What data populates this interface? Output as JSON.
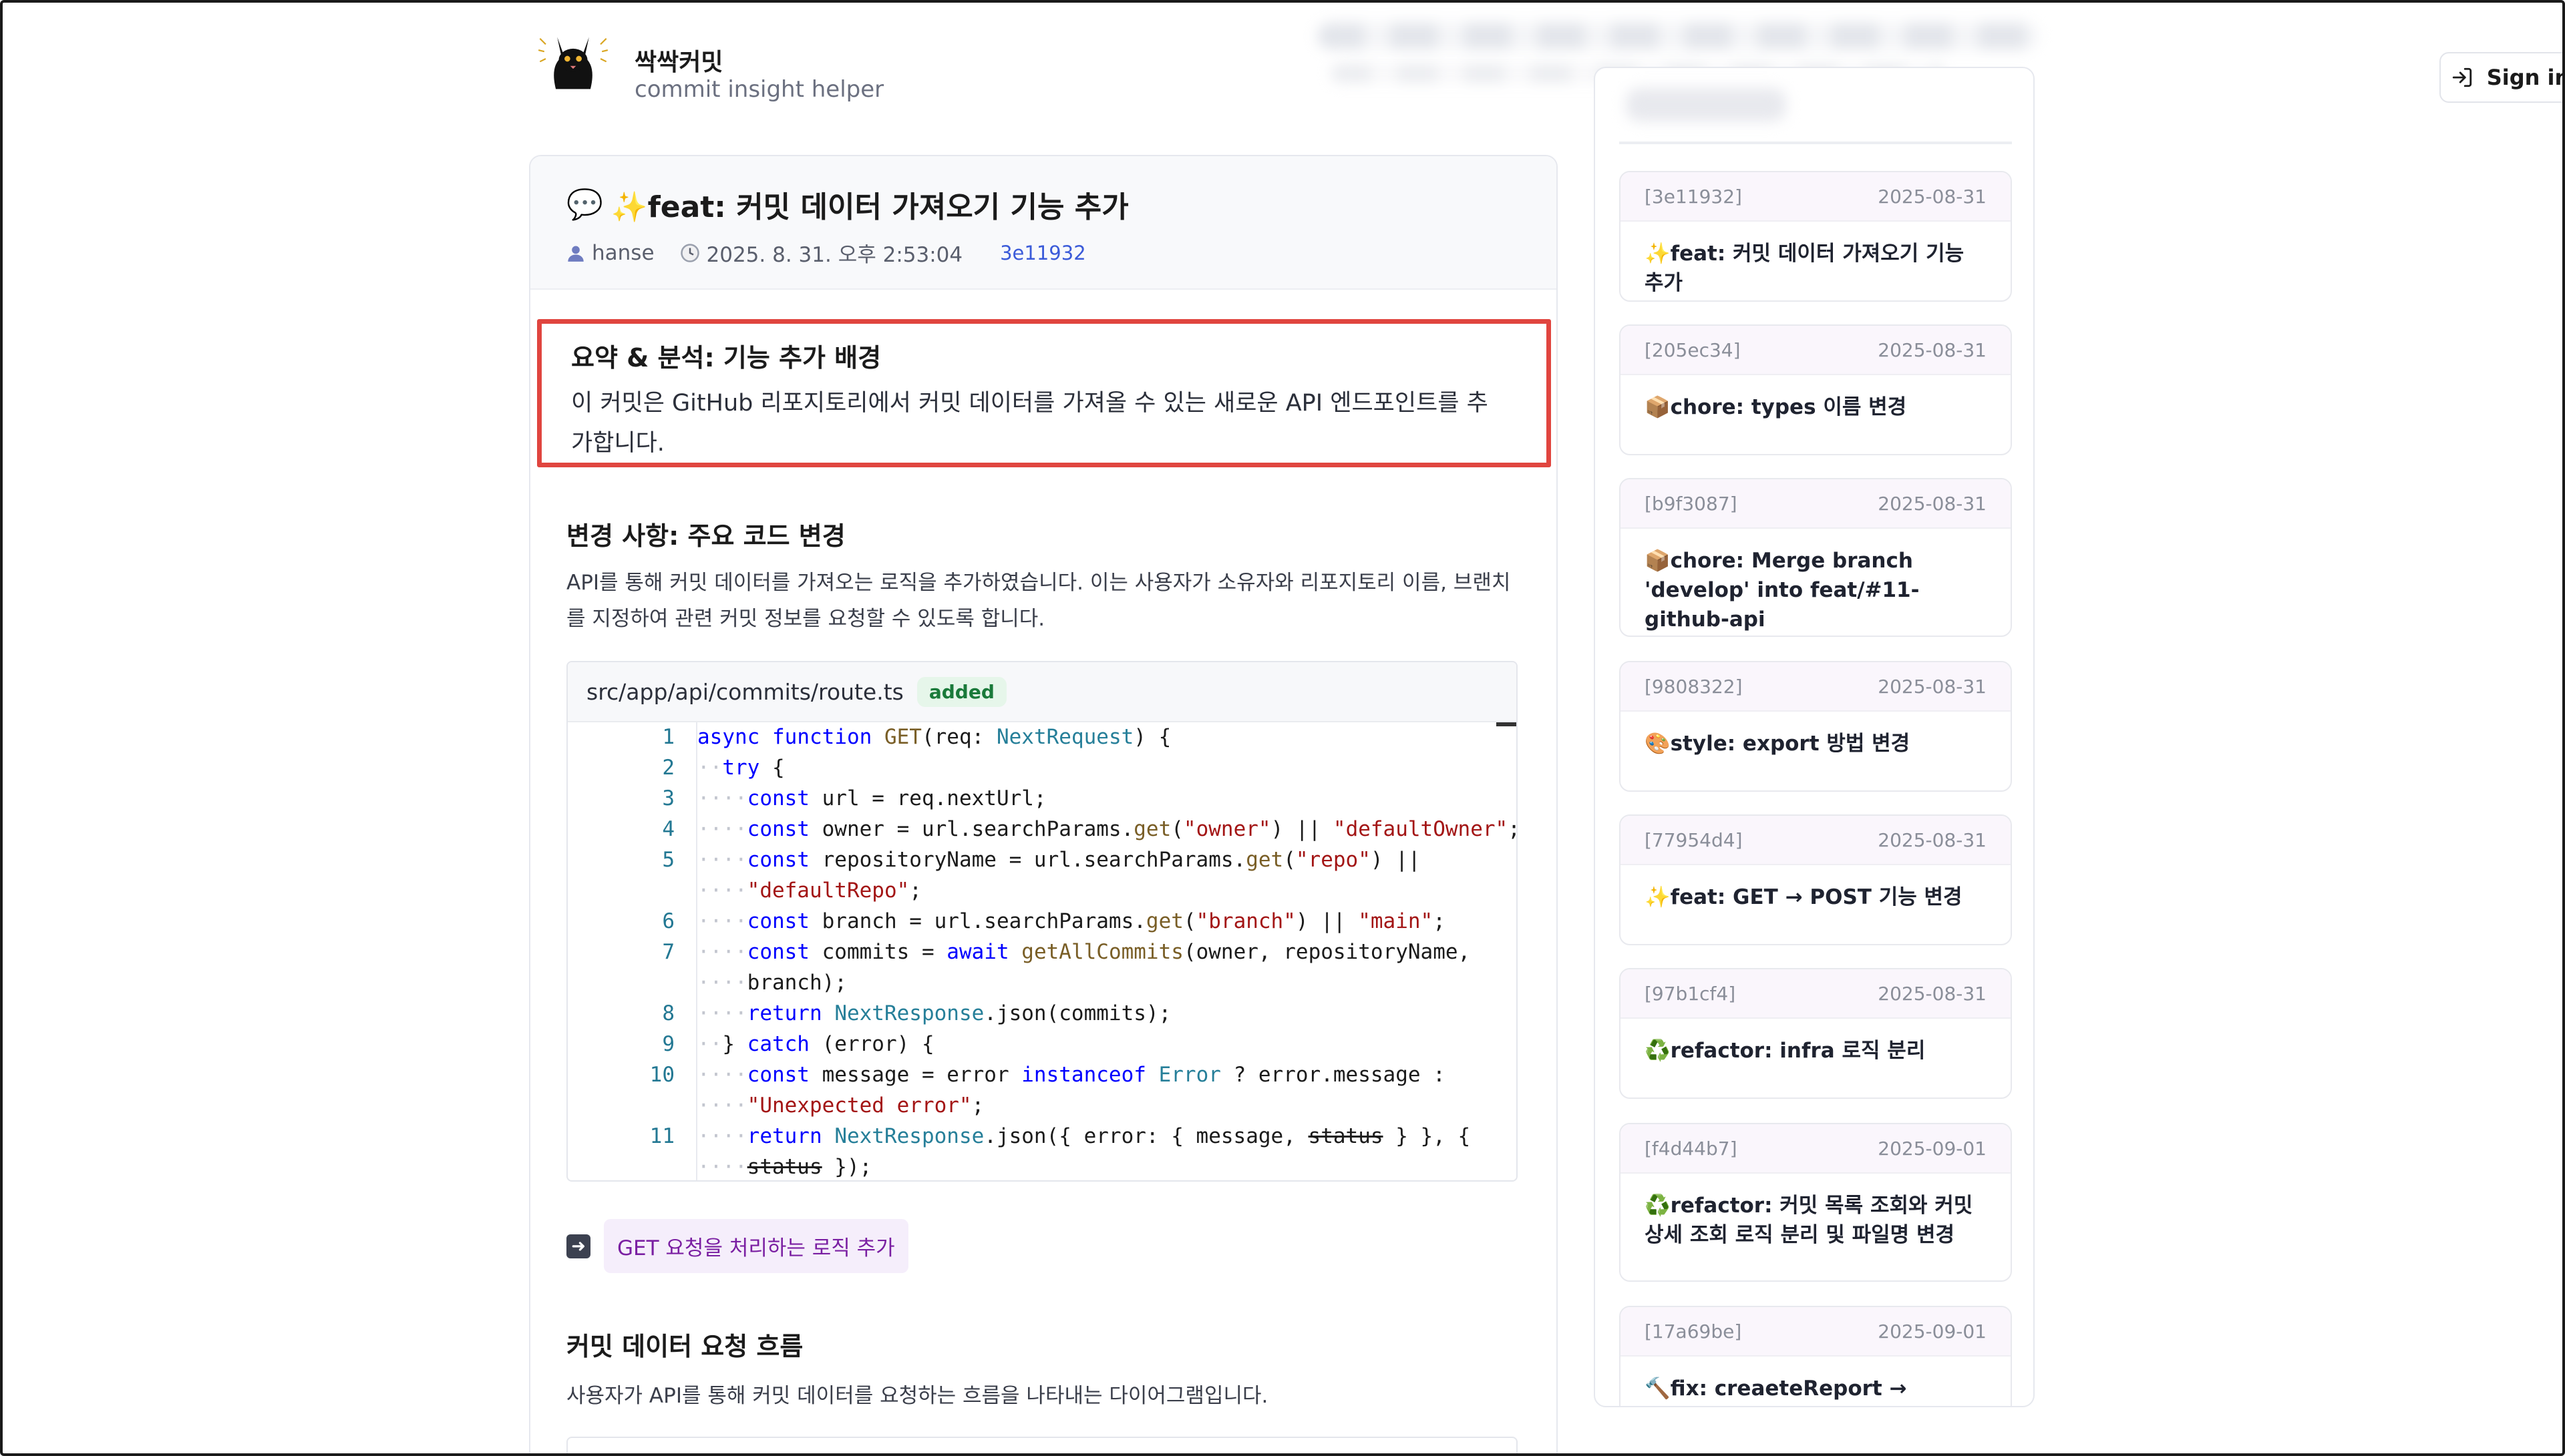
{
  "header": {
    "brand_name": "싹싹커밋",
    "brand_sub": "commit insight helper",
    "signin_label": "Sign in"
  },
  "commit": {
    "title_emoji": "💬",
    "title": "✨feat: 커밋 데이터 가져오기 기능 추가",
    "author": "hanse",
    "date": "2025. 8. 31. 오후 2:53:04",
    "hash": "3e11932"
  },
  "summary": {
    "title": "요약 & 분석: 기능 추가 배경",
    "text": "이 커밋은 GitHub 리포지토리에서 커밋 데이터를 가져올 수 있는 새로운 API 엔드포인트를 추가합니다."
  },
  "changes": {
    "title": "변경 사항: 주요 코드 변경",
    "desc": "API를 통해 커밋 데이터를 가져오는 로직을 추가하였습니다. 이는 사용자가 소유자와 리포지토리 이름, 브랜치를 지정하여 관련 커밋 정보를 요청할 수 있도록 합니다.",
    "file": "src/app/api/commits/route.ts",
    "file_status": "added",
    "note_label": "GET 요청을 처리하는 로직 추가"
  },
  "code_lines": [
    {
      "n": "1",
      "text": "async function GET(req: NextRequest) {"
    },
    {
      "n": "2",
      "text": "try {"
    },
    {
      "n": "3",
      "text": "const url = req.nextUrl;"
    },
    {
      "n": "4",
      "text": "const owner = url.searchParams.get(\"owner\") || \"defaultOwner\";"
    },
    {
      "n": "5",
      "text": "const repositoryName = url.searchParams.get(\"repo\") || \"defaultRepo\";"
    },
    {
      "n": "6",
      "text": "const branch = url.searchParams.get(\"branch\") || \"main\";"
    },
    {
      "n": "7",
      "text": "const commits = await getAllCommits(owner, repositoryName, branch);"
    },
    {
      "n": "8",
      "text": "return NextResponse.json(commits);"
    },
    {
      "n": "9",
      "text": "} catch (error) {"
    },
    {
      "n": "10",
      "text": "const message = error instanceof Error ? error.message : \"Unexpected error\";"
    },
    {
      "n": "11",
      "text": "return NextResponse.json({ error: { message, status } }, { status });"
    }
  ],
  "flow": {
    "title": "커밋 데이터 요청 흐름",
    "desc": "사용자가 API를 통해 커밋 데이터를 요청하는 흐름을 나타내는 다이어그램입니다."
  },
  "commits_list": [
    {
      "hash": "[3e11932]",
      "date": "2025-08-31",
      "msg": "✨feat: 커밋 데이터 가져오기 기능 추가"
    },
    {
      "hash": "[205ec34]",
      "date": "2025-08-31",
      "msg": "📦chore: types 이름 변경"
    },
    {
      "hash": "[b9f3087]",
      "date": "2025-08-31",
      "msg": "📦chore: Merge branch 'develop' into feat/#11-github-api"
    },
    {
      "hash": "[9808322]",
      "date": "2025-08-31",
      "msg": "🎨style: export 방법 변경"
    },
    {
      "hash": "[77954d4]",
      "date": "2025-08-31",
      "msg": "✨feat: GET → POST 기능 변경"
    },
    {
      "hash": "[97b1cf4]",
      "date": "2025-08-31",
      "msg": "♻️refactor: infra 로직 분리"
    },
    {
      "hash": "[f4d44b7]",
      "date": "2025-09-01",
      "msg": "♻️refactor: 커밋 목록 조회와 커밋 상세 조회 로직 분리 및 파일명 변경"
    },
    {
      "hash": "[17a69be]",
      "date": "2025-09-01",
      "msg": "🔨fix: creaeteReport →"
    }
  ],
  "colors": {
    "highlight_border": "#e0453f",
    "hash_link": "#3b5bd9",
    "pill_bg": "#f5eefb",
    "pill_text": "#7a1fa2"
  }
}
